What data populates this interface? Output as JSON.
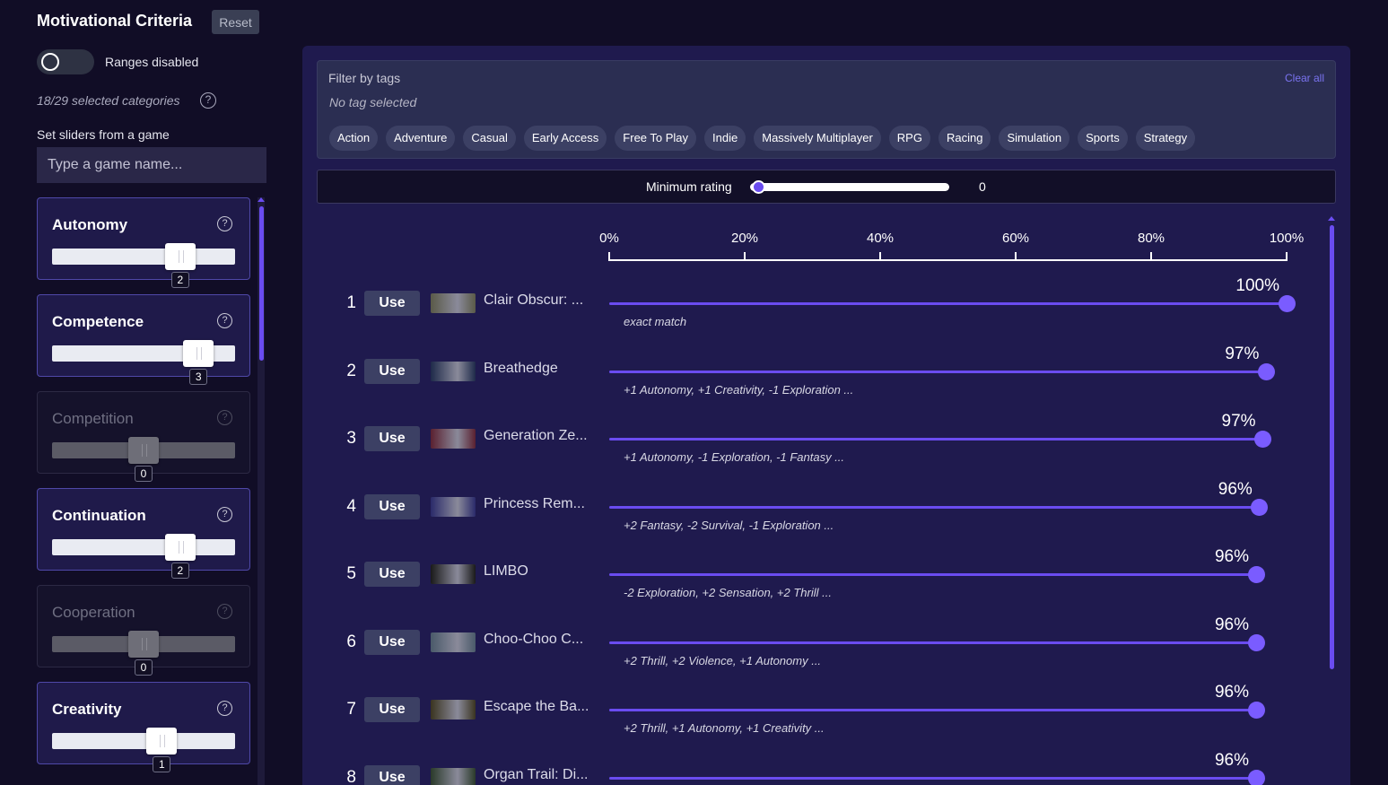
{
  "sidebar": {
    "title": "Motivational Criteria",
    "reset_label": "Reset",
    "toggle_label": "Ranges disabled",
    "selected_count": "18/29 selected categories",
    "help_glyph": "?",
    "set_from_game_label": "Set sliders from a game",
    "game_input_placeholder": "Type a game name...",
    "criteria": [
      {
        "name": "Autonomy",
        "value": "2",
        "enabled": true
      },
      {
        "name": "Competence",
        "value": "3",
        "enabled": true
      },
      {
        "name": "Competition",
        "value": "0",
        "enabled": false
      },
      {
        "name": "Continuation",
        "value": "2",
        "enabled": true
      },
      {
        "name": "Cooperation",
        "value": "0",
        "enabled": false
      },
      {
        "name": "Creativity",
        "value": "1",
        "enabled": true
      }
    ]
  },
  "filter": {
    "title": "Filter by tags",
    "none_selected": "No tag selected",
    "clear_all": "Clear all",
    "tags": [
      "Action",
      "Adventure",
      "Casual",
      "Early Access",
      "Free To Play",
      "Indie",
      "Massively Multiplayer",
      "RPG",
      "Racing",
      "Simulation",
      "Sports",
      "Strategy"
    ]
  },
  "rating": {
    "label": "Minimum rating",
    "value": "0"
  },
  "axis": {
    "ticks": [
      "0%",
      "20%",
      "40%",
      "60%",
      "80%",
      "100%"
    ]
  },
  "results": {
    "use_label": "Use",
    "rows": [
      {
        "rank": "1",
        "name": "Clair Obscur: ...",
        "pct": "100%",
        "match": 100,
        "diff": "exact match",
        "thumb_color": "#5a5a48"
      },
      {
        "rank": "2",
        "name": "Breathedge",
        "pct": "97%",
        "match": 97,
        "diff": "+1 Autonomy, +1 Creativity, -1 Exploration ...",
        "thumb_color": "#1e2a4a"
      },
      {
        "rank": "3",
        "name": "Generation Ze...",
        "pct": "97%",
        "match": 96.5,
        "diff": "+1 Autonomy, -1 Exploration, -1 Fantasy ...",
        "thumb_color": "#5a2030"
      },
      {
        "rank": "4",
        "name": "Princess Rem...",
        "pct": "96%",
        "match": 96,
        "diff": "+2 Fantasy, -2 Survival, -1 Exploration ...",
        "thumb_color": "#2a2a6a"
      },
      {
        "rank": "5",
        "name": "LIMBO",
        "pct": "96%",
        "match": 95.5,
        "diff": "-2 Exploration, +2 Sensation, +2 Thrill ...",
        "thumb_color": "#1a1a1a"
      },
      {
        "rank": "6",
        "name": "Choo-Choo C...",
        "pct": "96%",
        "match": 95.5,
        "diff": "+2 Thrill, +2 Violence, +1 Autonomy ...",
        "thumb_color": "#4a5a6a"
      },
      {
        "rank": "7",
        "name": "Escape the Ba...",
        "pct": "96%",
        "match": 95.5,
        "diff": "+2 Thrill, +1 Autonomy, +1 Creativity ...",
        "thumb_color": "#3a3420"
      },
      {
        "rank": "8",
        "name": "Organ Trail: Di...",
        "pct": "96%",
        "match": 95.5,
        "diff": "",
        "thumb_color": "#2a3a2a"
      }
    ]
  },
  "colors": {
    "accent": "#6a4cf0",
    "background": "#110d26",
    "panel": "#1f1a4e"
  }
}
